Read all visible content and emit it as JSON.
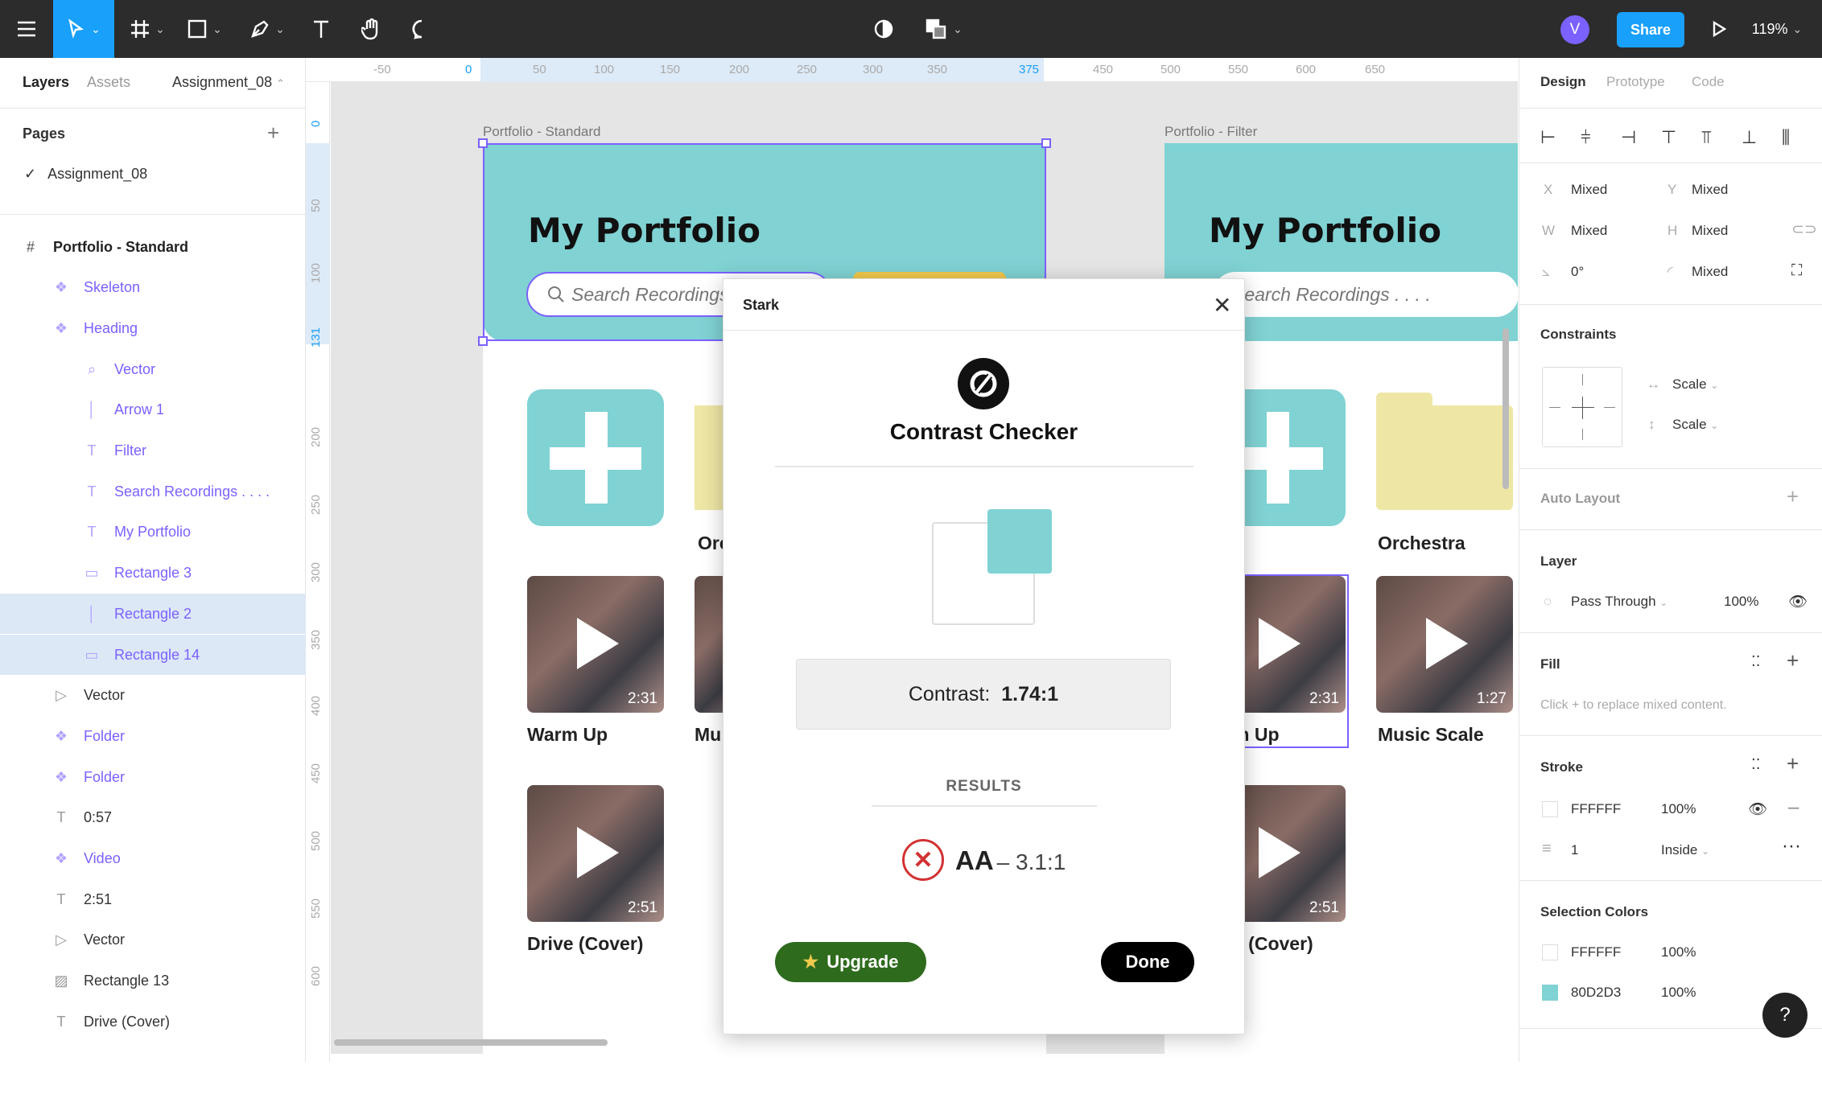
{
  "topbar": {
    "zoom": "119%",
    "share_label": "Share",
    "avatar_letter": "V"
  },
  "sidebar": {
    "tabs": [
      "Layers",
      "Assets"
    ],
    "file_name": "Assignment_08",
    "pages_label": "Pages",
    "current_page": "Assignment_08",
    "layers": [
      {
        "label": "Portfolio - Standard",
        "icon": "frame-icon"
      },
      {
        "label": "Skeleton",
        "icon": "component-icon"
      },
      {
        "label": "Heading",
        "icon": "component-icon"
      },
      {
        "label": "Vector",
        "icon": "search-icon"
      },
      {
        "label": "Arrow 1",
        "icon": "line-icon"
      },
      {
        "label": "Filter",
        "icon": "text-icon"
      },
      {
        "label": "Search Recordings . . . .",
        "icon": "text-icon"
      },
      {
        "label": "My Portfolio",
        "icon": "text-icon"
      },
      {
        "label": "Rectangle 3",
        "icon": "rectangle-icon"
      },
      {
        "label": "Rectangle 2",
        "icon": "line-icon"
      },
      {
        "label": "Rectangle 14",
        "icon": "rectangle-icon"
      },
      {
        "label": "Vector",
        "icon": "vector-icon"
      },
      {
        "label": "Folder",
        "icon": "component-icon"
      },
      {
        "label": "Folder",
        "icon": "component-icon"
      },
      {
        "label": "0:57",
        "icon": "text-icon"
      },
      {
        "label": "Video",
        "icon": "component-icon"
      },
      {
        "label": "2:51",
        "icon": "text-icon"
      },
      {
        "label": "Vector",
        "icon": "vector-icon"
      },
      {
        "label": "Rectangle 13",
        "icon": "image-icon"
      },
      {
        "label": "Drive (Cover)",
        "icon": "text-icon"
      }
    ]
  },
  "rulers": {
    "top": [
      "-50",
      "0",
      "50",
      "100",
      "150",
      "200",
      "250",
      "300",
      "350",
      "375",
      "450",
      "500",
      "550",
      "600",
      "650"
    ],
    "left": [
      "0",
      "50",
      "100",
      "131",
      "200",
      "250",
      "300",
      "350",
      "400",
      "450",
      "500",
      "550",
      "600"
    ]
  },
  "canvas": {
    "frame_standard_label": "Portfolio - Standard",
    "frame_filter_label": "Portfolio - Filter",
    "page_title": "My Portfolio",
    "search_placeholder": "Search Recordings . . . .",
    "folder_1_caption": "Orchestra",
    "folder_1_caption_clipped": "Orc",
    "video_1": {
      "caption": "Warm Up",
      "caption_clipped": "m Up",
      "duration": "2:31"
    },
    "video_2": {
      "caption": "Music Scale",
      "caption_clipped": "Mu:",
      "duration": "1:27"
    },
    "video_3": {
      "caption": "Drive (Cover)",
      "caption_clipped": "e (Cover)",
      "duration": "2:51"
    }
  },
  "modal": {
    "plugin_name": "Stark",
    "title": "Contrast Checker",
    "contrast_label": "Contrast:",
    "contrast_value": "1.74:1",
    "results_label": "RESULTS",
    "result_level": "AA",
    "result_ratio": "– 3.1:1",
    "upgrade_label": "Upgrade",
    "done_label": "Done"
  },
  "right_panel": {
    "tabs": [
      "Design",
      "Prototype",
      "Code"
    ],
    "x_label": "X",
    "x_value": "Mixed",
    "y_label": "Y",
    "y_value": "Mixed",
    "w_label": "W",
    "w_value": "Mixed",
    "h_label": "H",
    "h_value": "Mixed",
    "rotation_value": "0°",
    "radius_value": "Mixed",
    "constraints_label": "Constraints",
    "constraint_h": "Scale",
    "constraint_v": "Scale",
    "auto_layout_label": "Auto Layout",
    "layer_label": "Layer",
    "blend_mode": "Pass Through",
    "layer_opacity": "100%",
    "fill_label": "Fill",
    "fill_hint": "Click + to replace mixed content.",
    "stroke_label": "Stroke",
    "stroke_color": "FFFFFF",
    "stroke_opacity": "100%",
    "stroke_weight": "1",
    "stroke_position": "Inside",
    "selection_colors_label": "Selection Colors",
    "sel_color_1": "FFFFFF",
    "sel_color_1_opacity": "100%",
    "sel_color_2": "80D2D3",
    "sel_color_2_opacity": "100%",
    "help_label": "?"
  },
  "colors": {
    "accent": "#7b61ff",
    "teal": "#80d2d3",
    "share_blue": "#18a0fb",
    "folder_yellow": "#eee6a5",
    "upgrade_green": "#2e6b1d",
    "fail_red": "#d23232"
  }
}
